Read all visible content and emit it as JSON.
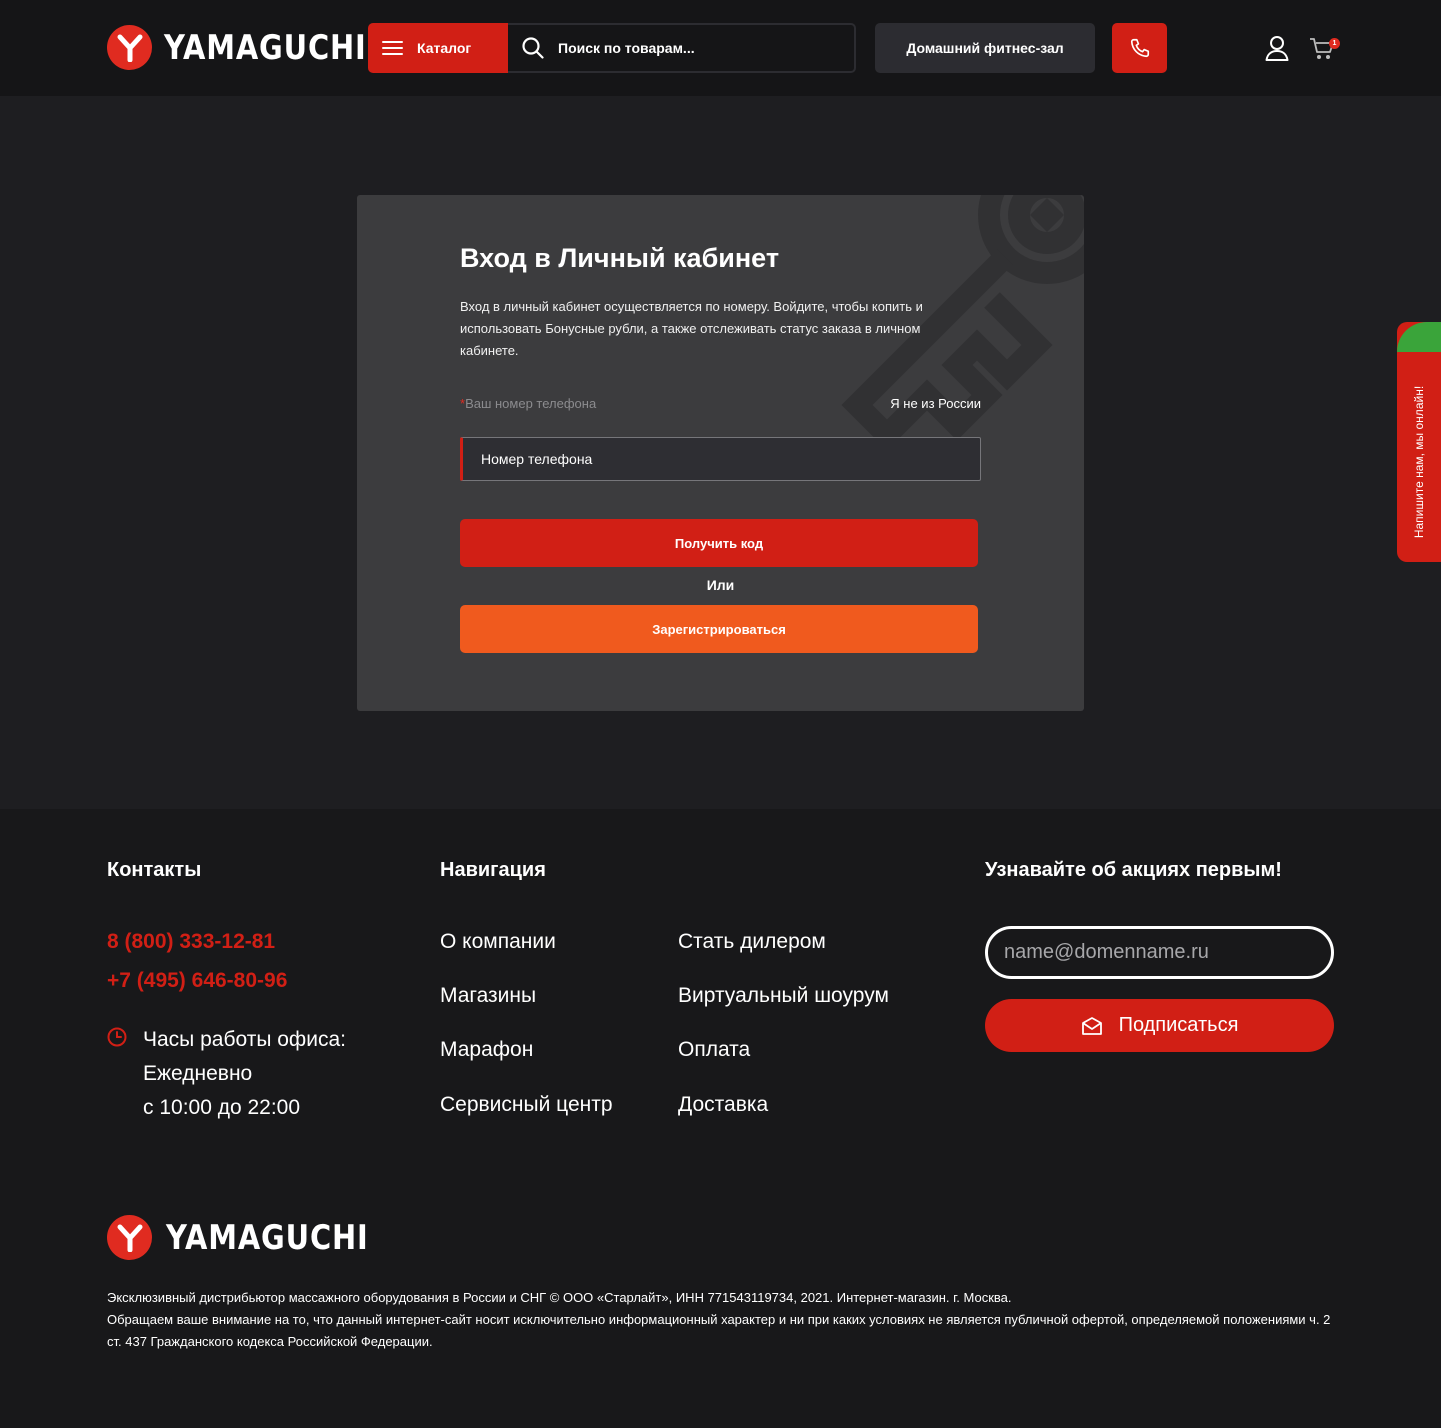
{
  "header": {
    "logo_text": "YAMAGUCHI",
    "catalog_label": "Каталог",
    "search_placeholder": "Поиск по товарам...",
    "fitness_label": "Домашний фитнес-зал",
    "cart_count": "1"
  },
  "login": {
    "title": "Вход в Личный кабинет",
    "description": "Вход в личный кабинет осуществляется по номеру. Войдите, чтобы копить и использовать Бонусные рубли, а также отслеживать статус заказа в личном кабинете.",
    "phone_label_required": "*",
    "phone_label": "Ваш номер телефона",
    "not_russia": "Я не из России",
    "phone_placeholder": "Номер телефона",
    "get_code": "Получить код",
    "or": "Или",
    "register": "Зарегистрироваться"
  },
  "chat": {
    "label": "Напишите нам, мы онлайн!"
  },
  "footer": {
    "contacts_title": "Контакты",
    "phone1": "8 (800) 333-12-81",
    "phone2": "+7 (495) 646-80-96",
    "hours_line1": "Часы работы офиса:",
    "hours_line2": "Ежедневно",
    "hours_line3": "с 10:00 до 22:00",
    "nav_title": "Навигация",
    "nav_col1": [
      "О компании",
      "Магазины",
      "Марафон",
      "Сервисный центр"
    ],
    "nav_col2": [
      "Стать дилером",
      "Виртуальный шоурум",
      "Оплата",
      "Доставка"
    ],
    "subscribe_title": "Узнавайте об акциях первым!",
    "email_placeholder": "name@domenname.ru",
    "subscribe_label": "Подписаться",
    "logo_text": "YAMAGUCHI",
    "legal1": "Эксклюзивный дистрибьютор массажного оборудования в России и СНГ © ООО «Старлайт», ИНН 771543119734, 2021. Интернет-магазин. г. Москва.",
    "legal2": "Обращаем ваше внимание на то, что данный интернет-сайт носит исключительно информационный характер и ни при каких условиях не является публичной офертой, определяемой положениями ч. 2 ст. 437 Гражданского кодекса Российской Федерации."
  },
  "colors": {
    "brand_red": "#d11f15",
    "orange": "#f05a1e",
    "chat_green": "#3aa43a"
  }
}
